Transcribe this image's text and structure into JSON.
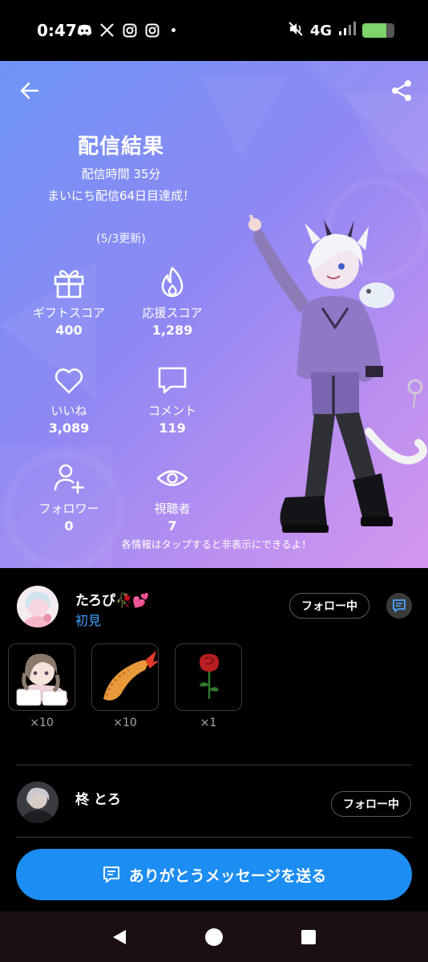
{
  "status": {
    "time": "0:47",
    "network": "4G",
    "battery_level": 0.75
  },
  "hero": {
    "title": "配信結果",
    "duration": "配信時間 35分",
    "streak": "まいにち配信64日目達成！",
    "updated": "(5/3更新)",
    "hint": "各情報はタップすると非表示にできるよ！",
    "stats": [
      {
        "label": "ギフトスコア",
        "value": "400",
        "icon": "gift-icon"
      },
      {
        "label": "応援スコア",
        "value": "1,289",
        "icon": "flame-icon"
      },
      {
        "label": "いいね",
        "value": "3,089",
        "icon": "heart-icon"
      },
      {
        "label": "コメント",
        "value": "119",
        "icon": "comment-icon"
      },
      {
        "label": "フォロワー",
        "value": "0",
        "icon": "add-user-icon"
      },
      {
        "label": "視聴者",
        "value": "7",
        "icon": "eye-icon"
      }
    ]
  },
  "supporters": [
    {
      "name": "たろぴ🥀💕",
      "badge": "初見",
      "follow_label": "フォロー中",
      "gifts": [
        {
          "name": "sticker-girl",
          "count": "×10"
        },
        {
          "name": "ebi-fry",
          "count": "×10"
        },
        {
          "name": "rose",
          "count": "×1"
        }
      ]
    },
    {
      "name": "柊 とろ",
      "follow_label": "フォロー中"
    }
  ],
  "cta": {
    "label": "ありがとうメッセージを送る"
  },
  "colors": {
    "accent": "#1c8df2",
    "link": "#3ea2ff",
    "hero_start": "#6f95f6",
    "hero_end": "#d496ee"
  }
}
